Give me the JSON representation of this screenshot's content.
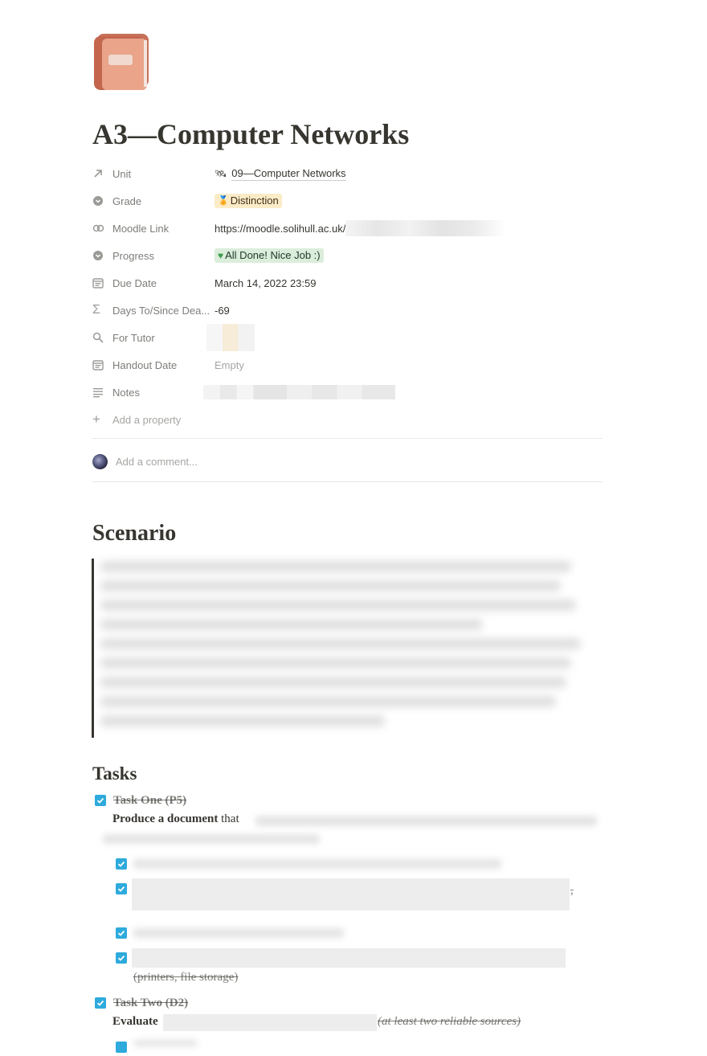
{
  "page": {
    "icon": "book-icon",
    "title": "A3—Computer Networks"
  },
  "properties": [
    {
      "name": "Unit",
      "icon": "arrow-up-right-icon",
      "value": "09—Computer Networks",
      "value_icon": "satellite-icon"
    },
    {
      "name": "Grade",
      "icon": "select-icon",
      "value": "Distinction",
      "value_icon": "medal-icon",
      "tag_color": "#fbecc7"
    },
    {
      "name": "Moodle Link",
      "icon": "link-icon",
      "value": "https://moodle.solihull.ac.uk/"
    },
    {
      "name": "Progress",
      "icon": "select-icon",
      "value": "All Done! Nice Job :)",
      "value_icon": "green-heart-icon",
      "tag_color": "#dbeddb"
    },
    {
      "name": "Due Date",
      "icon": "calendar-icon",
      "value": "March 14, 2022 23:59"
    },
    {
      "name": "Days To/Since Dea...",
      "icon": "sigma-icon",
      "value": "-69"
    },
    {
      "name": "For Tutor",
      "icon": "search-icon",
      "value": ""
    },
    {
      "name": "Handout Date",
      "icon": "calendar-icon",
      "value": "Empty"
    },
    {
      "name": "Notes",
      "icon": "text-lines-icon",
      "value": ""
    }
  ],
  "add_property_label": "Add a property",
  "comment": {
    "placeholder": "Add a comment..."
  },
  "scenario": {
    "heading": "Scenario"
  },
  "tasks": {
    "heading": "Tasks",
    "task_one": {
      "label": "Task One (P5)",
      "checked": true,
      "desc_bold": "Produce a document",
      "desc_rest": " that"
    },
    "subtasks_checked": [
      true,
      true,
      true,
      true
    ],
    "subtask_tail_2": ",",
    "subtask_tail_4": "(printers, file storage)",
    "task_two": {
      "label": "Task Two (D2)",
      "checked": true,
      "desc_bold": "Evaluate",
      "desc_tail": "(at least two reliable sources)"
    }
  },
  "colors": {
    "checkbox": "#2eaadc",
    "text": "#37352f"
  }
}
